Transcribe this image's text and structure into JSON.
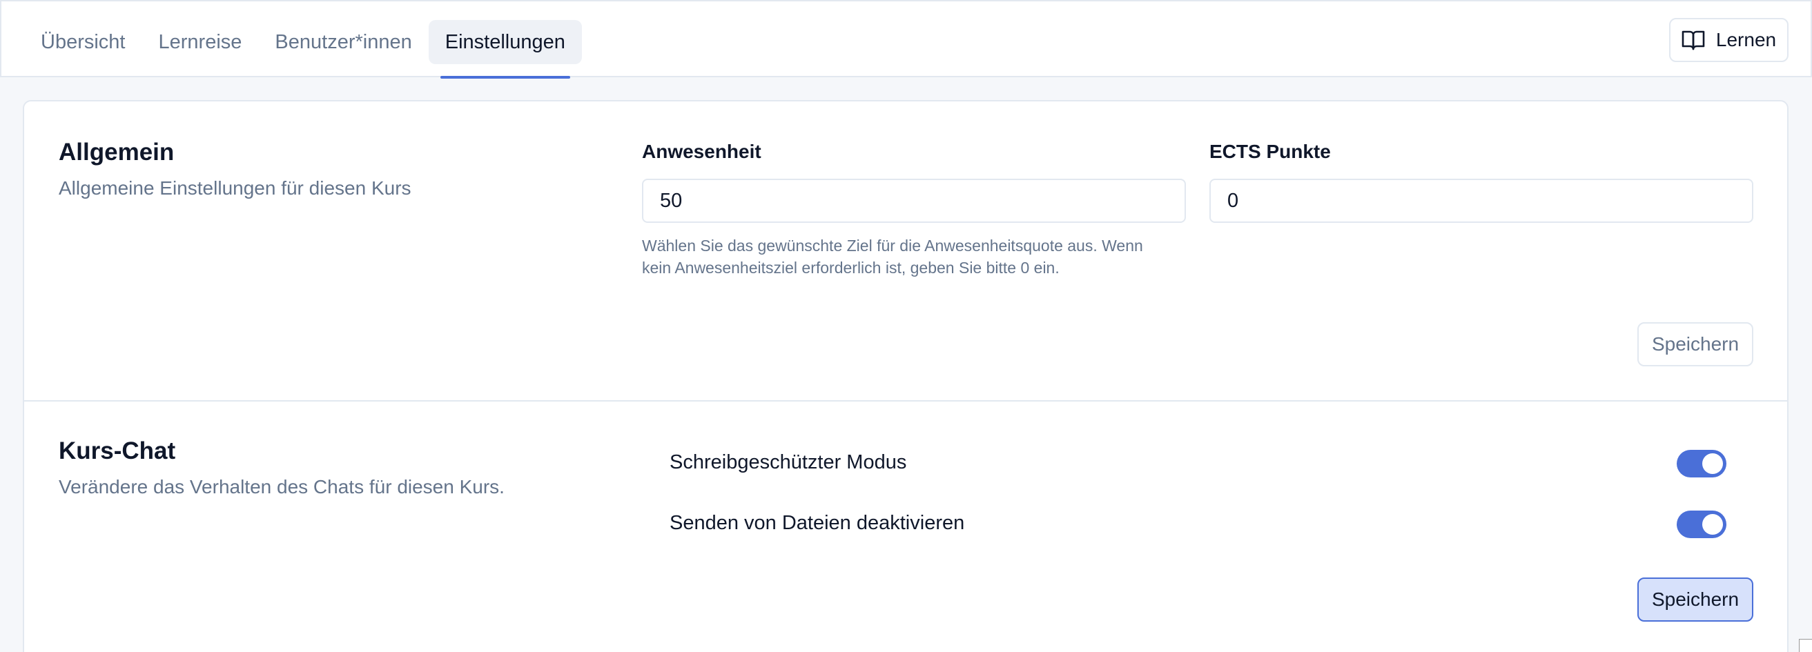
{
  "tabs": [
    {
      "label": "Übersicht"
    },
    {
      "label": "Lernreise"
    },
    {
      "label": "Benutzer*innen"
    },
    {
      "label": "Einstellungen"
    }
  ],
  "header": {
    "learn_button_label": "Lernen",
    "learn_icon": "book-open-icon"
  },
  "general": {
    "title": "Allgemein",
    "description": "Allgemeine Einstellungen für diesen Kurs",
    "attendance": {
      "label": "Anwesenheit",
      "value": "50",
      "hint_line1": "Wählen Sie das gewünschte Ziel für die Anwesenheitsquote aus. Wenn",
      "hint_line2": "kein Anwesenheitsziel erforderlich ist, geben Sie bitte 0 ein."
    },
    "ects": {
      "label": "ECTS Punkte",
      "value": "0"
    },
    "save_label": "Speichern"
  },
  "chat": {
    "title": "Kurs-Chat",
    "description": "Verändere das Verhalten des Chats für diesen Kurs.",
    "toggles": [
      {
        "label": "Schreibgeschützter Modus",
        "on": true
      },
      {
        "label": "Senden von Dateien deaktivieren",
        "on": true
      }
    ],
    "save_label": "Speichern"
  },
  "colors": {
    "accent": "#4a6fd8",
    "toggle_on": "#4a6fd8",
    "primary_button_bg": "#d7e1fb"
  }
}
